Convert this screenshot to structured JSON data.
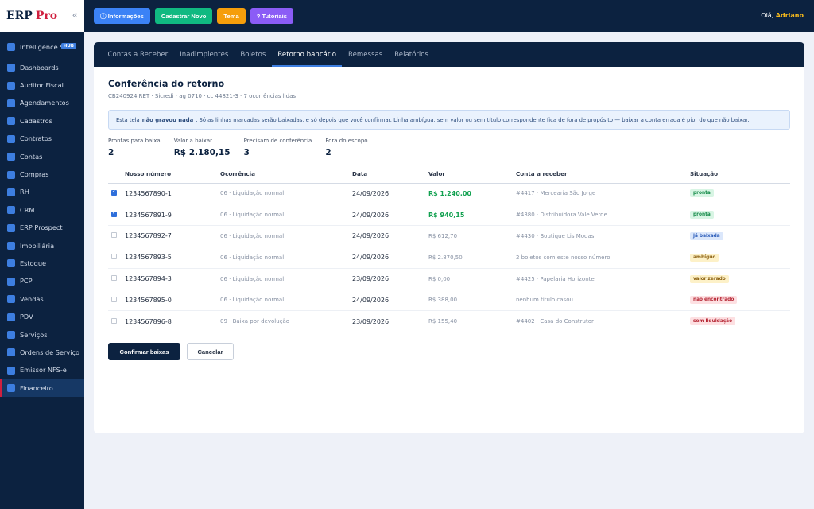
{
  "brand": {
    "name": "ERP",
    "suffix": "Pro",
    "collapse": "«"
  },
  "sidebar": {
    "items": [
      {
        "label": "Intelligence Suite",
        "badge": "HUB"
      },
      {
        "label": "Dashboards"
      },
      {
        "label": "Auditor Fiscal"
      },
      {
        "label": "Agendamentos"
      },
      {
        "label": "Cadastros"
      },
      {
        "label": "Contratos"
      },
      {
        "label": "Contas"
      },
      {
        "label": "Compras"
      },
      {
        "label": "RH"
      },
      {
        "label": "CRM"
      },
      {
        "label": "ERP Prospect"
      },
      {
        "label": "Imobiliária"
      },
      {
        "label": "Estoque"
      },
      {
        "label": "PCP"
      },
      {
        "label": "Vendas"
      },
      {
        "label": "PDV"
      },
      {
        "label": "Serviços"
      },
      {
        "label": "Ordens de Serviço"
      },
      {
        "label": "Emissor NFS-e"
      },
      {
        "label": "Financeiro"
      }
    ]
  },
  "topbar": {
    "buttons": [
      {
        "label": "ⓘ Informações",
        "color": "#3b82f6"
      },
      {
        "label": "Cadastrar Novo",
        "color": "#10b981"
      },
      {
        "label": "Tema",
        "color": "#f59e0b"
      },
      {
        "label": "? Tutoriais",
        "color": "#8b5cf6"
      }
    ],
    "greeting": "Olá,",
    "user": "Adriano"
  },
  "tabs": [
    "Contas a Receber",
    "Inadimplentes",
    "Boletos",
    "Retorno bancário",
    "Remessas",
    "Relatórios"
  ],
  "page": {
    "title": "Conferência do retorno",
    "subtitle": "CB240924.RET · Sicredi · ag 0710 · cc 44821-3 · 7 ocorrências lidas",
    "notice_pre": "Esta tela",
    "notice_bold": "não gravou nada",
    "notice_post": ". Só as linhas marcadas serão baixadas, e só depois que você confirmar. Linha ambígua, sem valor ou sem título correspondente fica de fora de propósito — baixar a conta errada é pior do que não baixar."
  },
  "stats": [
    {
      "label": "Prontas para baixa",
      "value": "2"
    },
    {
      "label": "Valor a baixar",
      "value": "R$ 2.180,15"
    },
    {
      "label": "Precisam de conferência",
      "value": "3"
    },
    {
      "label": "Fora do escopo",
      "value": "2"
    }
  ],
  "table": {
    "headers": [
      "Nosso número",
      "Ocorrência",
      "Data",
      "Valor",
      "Conta a receber",
      "Situação"
    ],
    "rows": [
      {
        "nn": "1234567890-1",
        "oc": "06 · Liquidação normal",
        "data": "24/09/2026",
        "valor": "R$ 1.240,00",
        "conta": "#4417 · Mercearia São Jorge",
        "sit": "pronta"
      },
      {
        "nn": "1234567891-9",
        "oc": "06 · Liquidação normal",
        "data": "24/09/2026",
        "valor": "R$ 940,15",
        "conta": "#4380 · Distribuidora Vale Verde",
        "sit": "pronta"
      },
      {
        "nn": "1234567892-7",
        "oc": "06 · Liquidação normal",
        "data": "24/09/2026",
        "valor": "R$ 612,70",
        "conta": "#4430 · Boutique Lis Modas",
        "sit": "já baixada"
      },
      {
        "nn": "1234567893-5",
        "oc": "06 · Liquidação normal",
        "data": "24/09/2026",
        "valor": "R$ 2.870,50",
        "conta": "2 boletos com este nosso número",
        "sit": "ambíguo"
      },
      {
        "nn": "1234567894-3",
        "oc": "06 · Liquidação normal",
        "data": "23/09/2026",
        "valor": "R$ 0,00",
        "conta": "#4425 · Papelaria Horizonte",
        "sit": "valor zerado"
      },
      {
        "nn": "1234567895-0",
        "oc": "06 · Liquidação normal",
        "data": "24/09/2026",
        "valor": "R$ 388,00",
        "conta": "nenhum título casou",
        "sit": "não encontrado"
      },
      {
        "nn": "1234567896-8",
        "oc": "09 · Baixa por devolução",
        "data": "23/09/2026",
        "valor": "R$ 155,40",
        "conta": "#4402 · Casa do Construtor",
        "sit": "sem liquidação"
      }
    ]
  },
  "actions": {
    "confirm": "Confirmar baixas",
    "cancel": "Cancelar"
  }
}
